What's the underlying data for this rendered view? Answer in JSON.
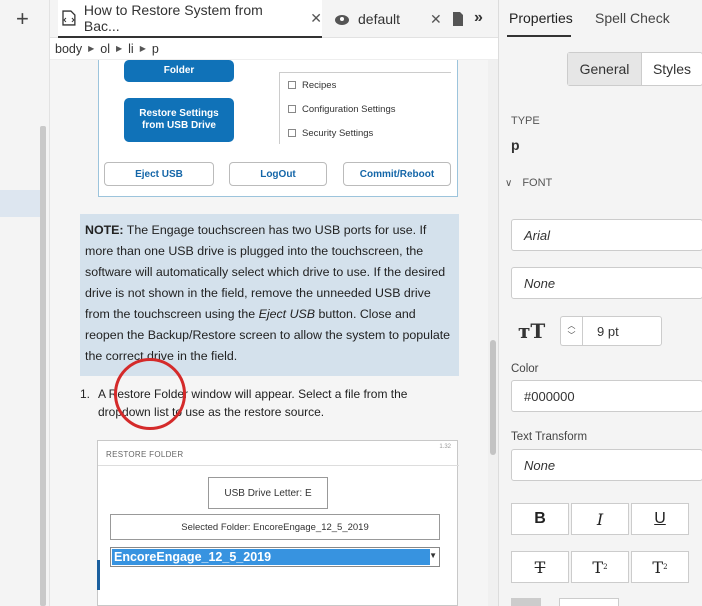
{
  "left_rail": {
    "add_icon": "plus-icon"
  },
  "tabs": [
    {
      "label": "How to Restore System from Bac...",
      "icon": "document-icon",
      "active": true
    },
    {
      "label": "default",
      "icon": "gear-cube-icon",
      "active": false
    }
  ],
  "tab_close_glyph": "✕",
  "breadcrumb": [
    "body",
    "ol",
    "li",
    "p"
  ],
  "screenshot1": {
    "folder_btn": "Folder",
    "restore_btn": "Restore Settings\nfrom USB Drive",
    "checkboxes": [
      "Recipes",
      "Configuration Settings",
      "Security Settings"
    ],
    "eject_btn": "Eject USB",
    "logout_btn": "LogOut",
    "commit_btn": "Commit/Reboot"
  },
  "note": {
    "label": "NOTE:",
    "text_before": " The Engage touchscreen has two USB ports for use.  If more than one USB drive is plugged into the touchscreen, the software will automatically select which drive to use.  If the desired drive is not shown in the field, remove the unneeded USB drive from the touchscreen using the ",
    "italic": "Eject USB",
    "text_after": " button. Close and reopen the Backup/Restore screen to allow the system to populate the correct drive in the field."
  },
  "list_item": {
    "number": "1.",
    "text": "A Restore Folder window will appear.  Select a file from the dropdown list to use as the restore source."
  },
  "screenshot2": {
    "header": "RESTORE FOLDER",
    "version": "1.32",
    "usb_label": "USB Drive Letter: E",
    "selected_folder": "Selected Folder: EncoreEngage_12_5_2019",
    "dropdown_value": "EncoreEngage_12_5_2019"
  },
  "panel": {
    "tabs": [
      "Properties",
      "Spell Check"
    ],
    "segments": [
      "General",
      "Styles"
    ],
    "type_label": "TYPE",
    "type_value": "p",
    "font_section": "FONT",
    "font_family": "Arial",
    "font_style": "None",
    "font_size": "9 pt",
    "color_label": "Color",
    "color_value": "#000000",
    "text_transform_label": "Text Transform",
    "text_transform_value": "None",
    "bold": "B",
    "italic": "I",
    "underline": "U",
    "strike": "T",
    "superscript": "T",
    "subscript": "T",
    "sup_mark": "2",
    "sub_mark": "2"
  },
  "colors": {
    "accent_blue": "#1072b8",
    "note_bg": "#d4e1ec",
    "annotation_red": "#d42a2a"
  }
}
